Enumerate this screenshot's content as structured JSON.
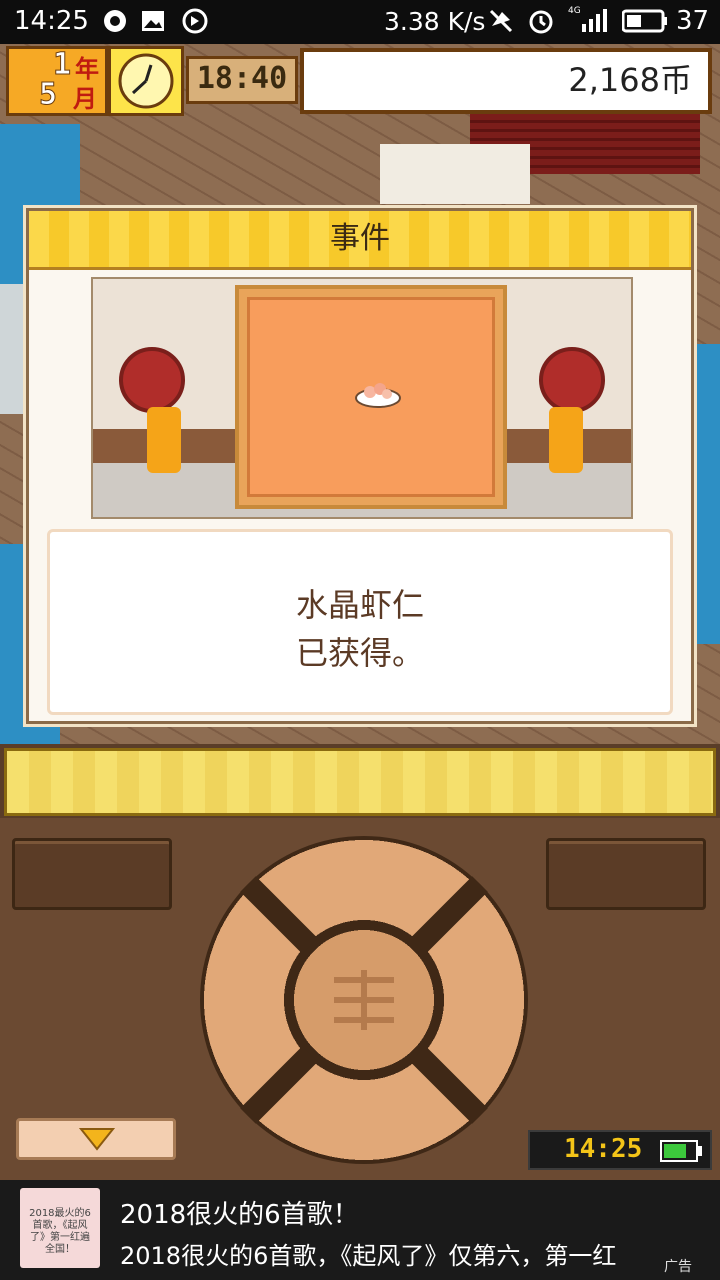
{
  "status_bar": {
    "time": "14:25",
    "net_speed": "3.38 K/s",
    "network_type": "4G",
    "battery": "37",
    "icons": [
      "app-icon",
      "gallery-icon",
      "sync-icon",
      "mute-icon",
      "alarm-icon",
      "signal-icon",
      "battery-icon"
    ]
  },
  "hud": {
    "year_num": "1",
    "year_unit": "年",
    "month_num": "5",
    "month_unit": "月",
    "time": "18:40",
    "coins": "2,168币"
  },
  "dialog": {
    "title": "事件",
    "message_line1": "水晶虾仁",
    "message_line2": "已获得。",
    "item_icon": "shrimp-dish-icon"
  },
  "controls": {
    "mini_clock": "14:25",
    "down_icon": "triangle-down-icon"
  },
  "ad": {
    "thumb_text": "2018最火的6首歌，《起风了》第一红遍全国！",
    "title": "2018很火的6首歌！",
    "description": "2018很火的6首歌，《起风了》仅第六，第一红",
    "tag": "广告"
  },
  "colors": {
    "accent_yellow": "#f7c92a",
    "panel_brown": "#6b4a32",
    "text_brown": "#5b3a25"
  }
}
